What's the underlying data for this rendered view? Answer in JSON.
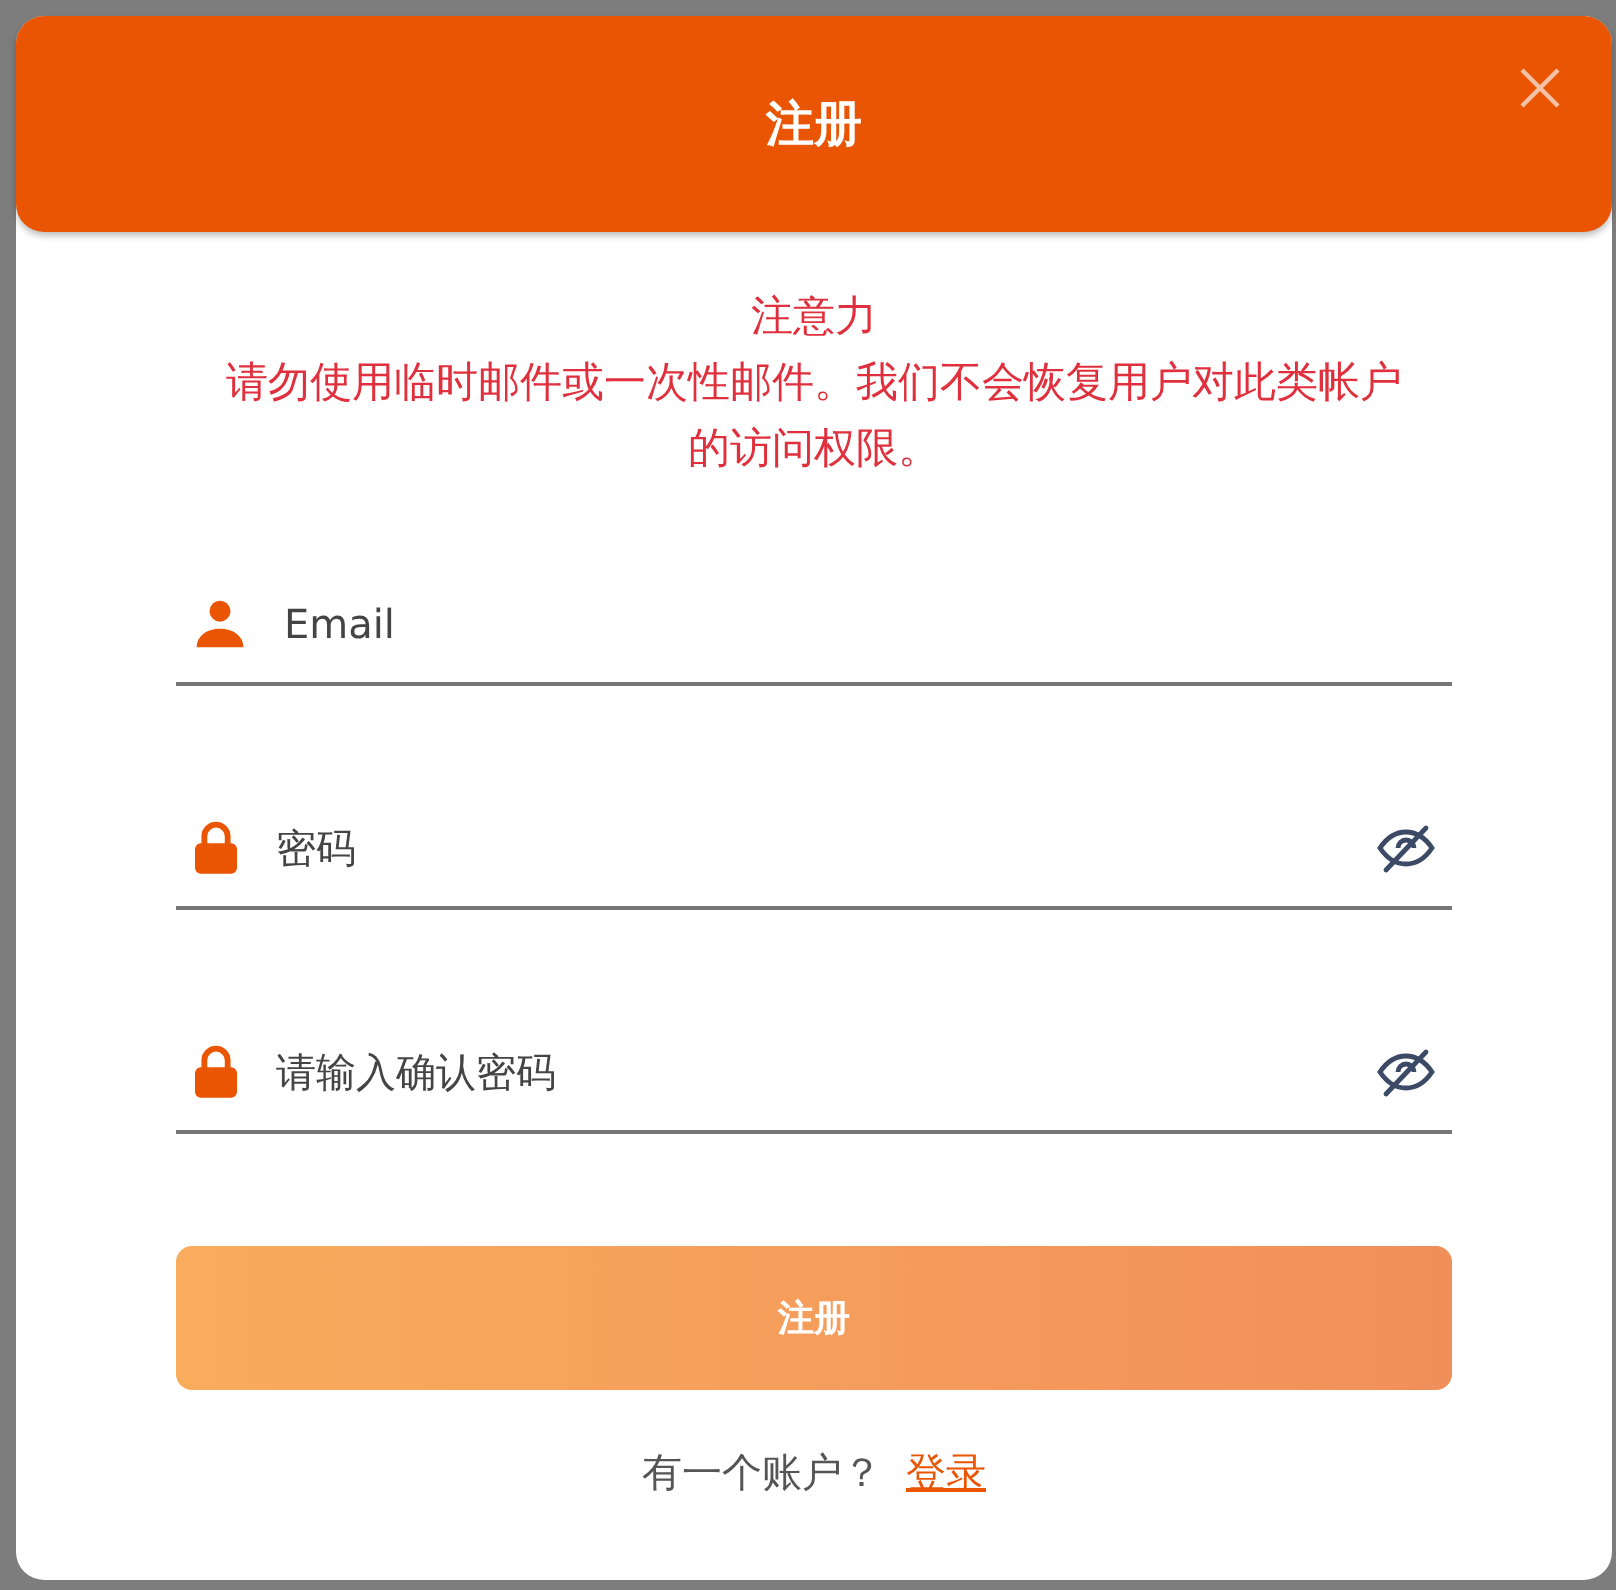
{
  "dialog": {
    "title": "注册",
    "notice": {
      "heading": "注意力",
      "text": "请勿使用临时邮件或一次性邮件。我们不会恢复用户对此类帐户的访问权限。"
    },
    "fields": [
      {
        "kind": "email",
        "placeholder": "Email",
        "password_toggle": false
      },
      {
        "kind": "password",
        "placeholder": "密码",
        "password_toggle": true
      },
      {
        "kind": "password",
        "placeholder": "请输入确认密码",
        "password_toggle": true
      }
    ],
    "submit_button": "注册",
    "footer": {
      "text": "有一个账户？",
      "link": "登录"
    }
  }
}
